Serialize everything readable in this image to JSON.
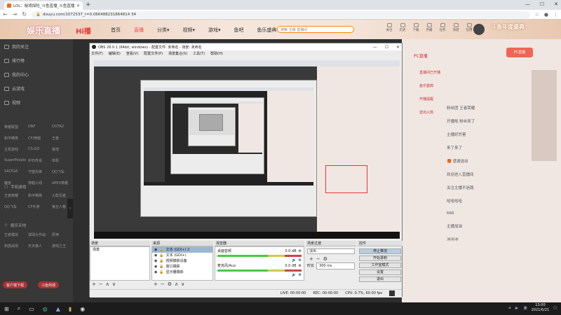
{
  "browser": {
    "tab_title": "LOL：秘境探险_斗鱼直播_斗鱼直播",
    "new_tab": "+",
    "url": "douyu.com/1072537_r=0.066488231864814 34",
    "controls": [
      "—",
      "☐",
      "✕"
    ]
  },
  "douyu": {
    "logo": "娱乐直播",
    "logo2": "Hi播",
    "nav": [
      "首页",
      "直播",
      "分类▾",
      "视频▾",
      "游戏▾",
      "鱼吧",
      "鱼乐盛典"
    ],
    "search_placeholder": "搜索 主播 直播间",
    "icons": [
      "关注",
      "历史",
      "下载",
      "开播",
      "任务",
      "消息",
      "信用"
    ],
    "banner": "斗鱼年度盛典",
    "sidebar": [
      "我的关注",
      "排行榜",
      "我的中心",
      "云游戏",
      "视频"
    ],
    "sidebar_grid": [
      "英雄联盟",
      "DNF",
      "DOTA2",
      "和平精英",
      "CF/穿越",
      "王者",
      "主机游戏",
      "CS:GO",
      "其他",
      "SuperPeople",
      "炉石传说",
      "单机",
      "SALTGA",
      "守望先锋",
      "QQ飞车",
      "魔兽",
      "穿越火线",
      "APEX英雄"
    ],
    "sidebar_sec": [
      "手机游戏",
      "娱乐天地"
    ],
    "sidebar_sec_grid": [
      "王者荣耀",
      "和平精英",
      "火影忍者",
      "QQ飞车",
      "CF手游",
      "第五人格",
      "王者模拟",
      "球球大作战",
      "原神",
      "刺激战场",
      "天天狼人",
      "游戏之王"
    ],
    "bottom_buttons": [
      "客户端下载",
      "斗鱼商城"
    ]
  },
  "obs": {
    "title": "OBS 26.0.1 (64bit, windows) - 配置文件: 未命名 - 场景: 未命名",
    "menu": [
      "文件(F)",
      "编辑(E)",
      "查看(V)",
      "配置文件(P)",
      "场景集合(S)",
      "工具(T)",
      "帮助(H)"
    ],
    "docks": {
      "scenes": {
        "title": "场景",
        "items": [
          "场景"
        ]
      },
      "sources": {
        "title": "来源",
        "items": [
          "文本 (GDI+) 2",
          "文本 (GDI+)",
          "视频捕获设备",
          "窗口捕获",
          "显示器捕获"
        ]
      },
      "mixer": {
        "title": "混音器",
        "tracks": [
          {
            "name": "麦克风/Aux",
            "db": "0.0 dB"
          },
          {
            "name": "桌面音频",
            "db": "0.0 dB"
          }
        ]
      },
      "transitions": {
        "title": "场景过渡",
        "type": "淡出",
        "duration_label": "时长",
        "duration": "300 ms"
      },
      "controls": {
        "title": "控件",
        "buttons": [
          "停止推流",
          "开始录制",
          "工作室模式",
          "设置",
          "退出"
        ]
      }
    },
    "status": {
      "live": "LIVE: 00:00:00",
      "rec": "REC: 00:00:00",
      "cpu": "CPU: 0.7%, 60.00 fps"
    }
  },
  "chat": {
    "lines": [
      "粉丝团 王者荣耀",
      "开播啦 粉丝来了",
      "主播好厉害",
      "来了来了",
      "🎁 感谢送出",
      "欢迎进入直播间",
      "关注主播不迷路",
      "哈哈哈哈",
      "666",
      "主播加油",
      "冲冲冲"
    ],
    "lines_right": [
      "直播间已开播",
      "鱼乐盛典",
      "开播提醒",
      "送出火箭",
      "PC直播"
    ]
  },
  "taskbar": {
    "time": "13:00",
    "date": "2021/6/21"
  }
}
